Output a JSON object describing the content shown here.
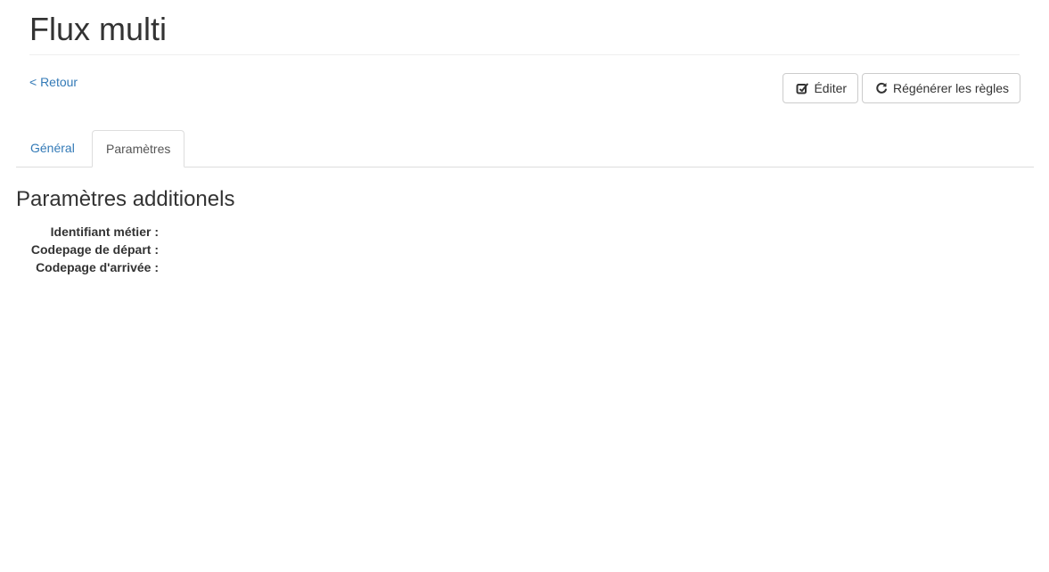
{
  "header": {
    "title": "Flux multi"
  },
  "nav": {
    "back_label": "< Retour"
  },
  "toolbar": {
    "edit_label": "Éditer",
    "edit_icon": "edit-icon",
    "regenerate_label": "Régénérer les règles",
    "regenerate_icon": "refresh-icon"
  },
  "tabs": [
    {
      "label": "Général",
      "active": false
    },
    {
      "label": "Paramètres",
      "active": true
    }
  ],
  "section": {
    "title": "Paramètres additionels",
    "fields": [
      {
        "label": "Identifiant métier :",
        "value": ""
      },
      {
        "label": "Codepage de départ :",
        "value": ""
      },
      {
        "label": "Codepage d'arrivée :",
        "value": ""
      }
    ]
  },
  "colors": {
    "link": "#337ab7",
    "text": "#333333",
    "border": "#cccccc",
    "tab_border": "#dddddd"
  }
}
